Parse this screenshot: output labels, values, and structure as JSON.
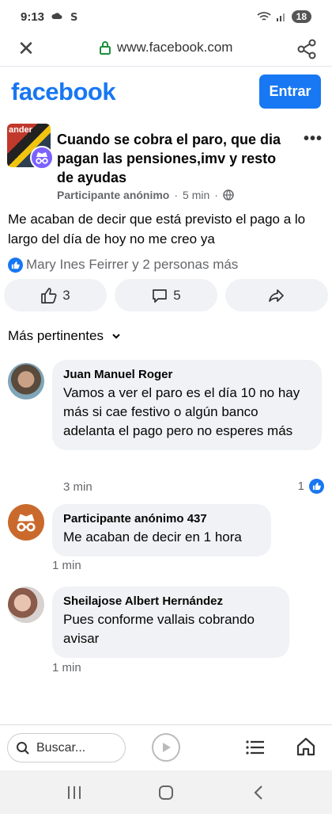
{
  "status_bar": {
    "time": "9:13",
    "battery": "18"
  },
  "browser": {
    "url": "www.facebook.com"
  },
  "header": {
    "logo": "facebook",
    "login_button": "Entrar"
  },
  "post": {
    "group_thumb_text": "ander",
    "title": "Cuando se cobra el paro, que dia pagan las pensiones,imv y resto de  ayudas",
    "author": "Participante anónimo",
    "separator": "·",
    "time": "5 min",
    "body": "Me acaban de decir que está previsto el pago a lo largo del día de hoy no me creo  ya",
    "reactions_text": "Mary Ines Feirrer y 2 personas más",
    "like_count": "3",
    "comment_count": "5"
  },
  "sort_label": "Más pertinentes",
  "comments": [
    {
      "author": "Juan Manuel Roger",
      "text": "Vamos a ver el paro es el día 10 no hay más si cae festivo o algún banco adelanta el pago pero no esperes más",
      "time": "3 min",
      "likes": "1"
    },
    {
      "author": "Participante anónimo 437",
      "text": "Me acaban de decir en 1 hora",
      "time": "1 min"
    },
    {
      "author": "Sheilajose Albert Hernández",
      "text": "Pues conforme vallais cobrando avisar",
      "time": "1 min"
    }
  ],
  "bottom_bar": {
    "search_placeholder": "Buscar..."
  },
  "colors": {
    "brand": "#1877f2",
    "bubble": "#f0f2f5",
    "meta": "#65676b"
  },
  "icons": [
    "close-icon",
    "lock-icon",
    "share-icon",
    "anonymous-icon",
    "more-icon",
    "globe-icon",
    "like-icon",
    "comment-icon",
    "forward-icon",
    "chevron-down-icon",
    "search-icon",
    "play-icon",
    "menu-icon",
    "home-icon"
  ]
}
